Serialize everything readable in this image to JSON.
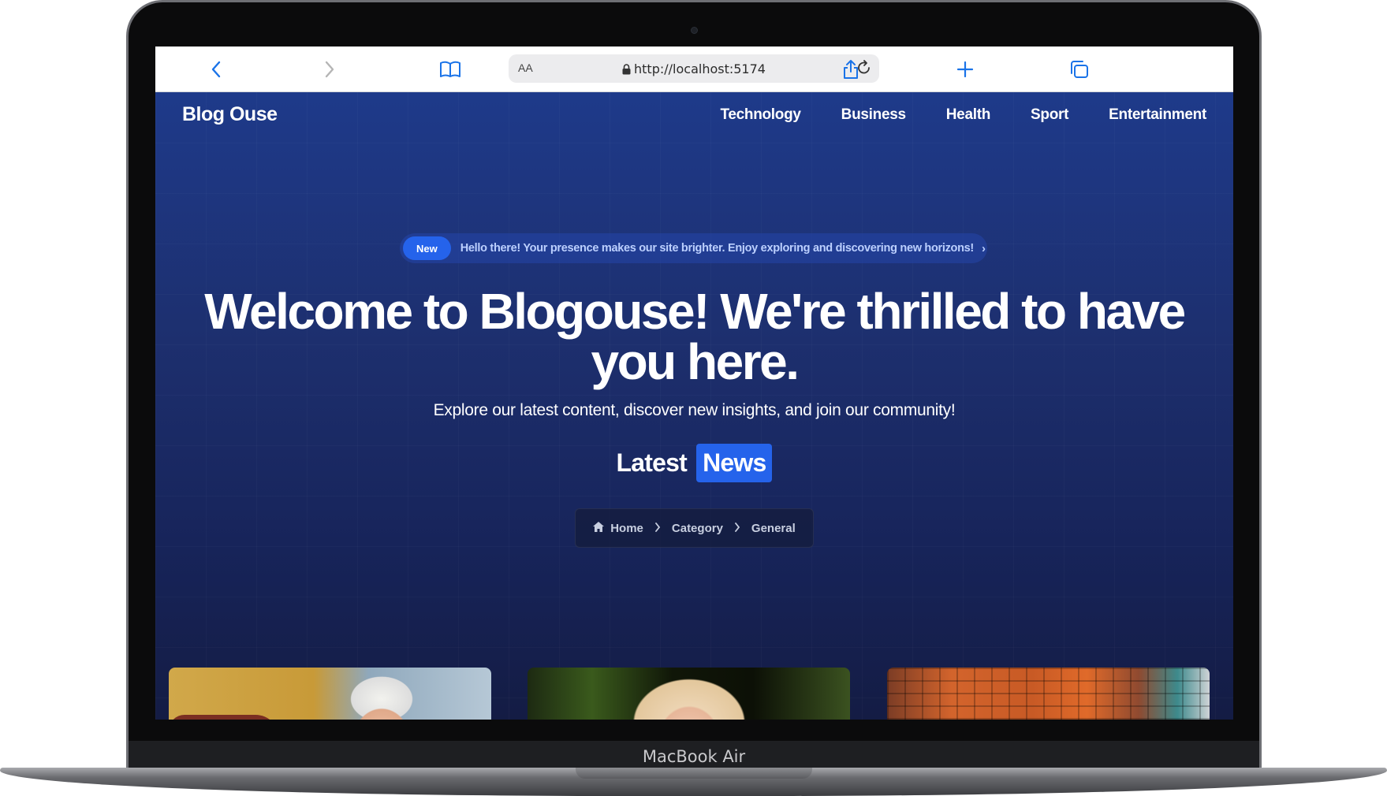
{
  "device": {
    "label": "MacBook Air"
  },
  "browser": {
    "aa_label": "AA",
    "url": "http://localhost:5174",
    "icons": [
      "back-icon",
      "forward-icon",
      "bookmarks-icon",
      "lock-icon",
      "reload-icon",
      "share-icon",
      "new-tab-icon",
      "tabs-icon"
    ]
  },
  "site": {
    "brand": "Blog Ouse",
    "nav": [
      "Technology",
      "Business",
      "Health",
      "Sport",
      "Entertainment"
    ]
  },
  "announcement": {
    "badge": "New",
    "text": "Hello there! Your presence makes our site brighter. Enjoy exploring and discovering new horizons!"
  },
  "hero": {
    "headline": "Welcome to Blogouse! We're thrilled to have you here.",
    "subheadline": "Explore our latest content, discover new insights, and join our community!",
    "section_title_plain": "Latest",
    "section_title_highlight": "News"
  },
  "breadcrumb": [
    "Home",
    "Category",
    "General"
  ],
  "colors": {
    "accent": "#2563eb",
    "hero_top": "#1e3a8a",
    "hero_bottom": "#141c44"
  }
}
